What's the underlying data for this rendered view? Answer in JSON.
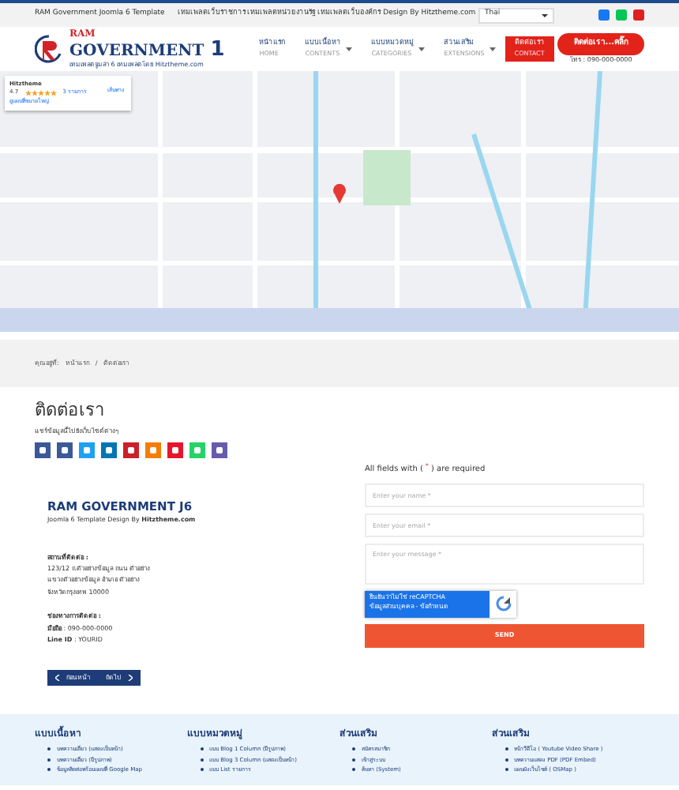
{
  "top_bar": {
    "site": "RAM Government Joomla 6 Template",
    "tagline": "เทมเพลตเว็บราชการ เทมเพลตหน่วยงานรัฐ เทมเพลตเว็บองค์กร Design By Hitztheme.com",
    "language": "Thai"
  },
  "logo": {
    "mark": "RAM",
    "name": "GOVERNMENT",
    "number": "1",
    "subtitle": "เทมเพลตจูมล่า 6 เทมเพลตโดย Hitztheme.com"
  },
  "nav": [
    {
      "label": "หน้าแรก",
      "sub": "HOME",
      "dropdown": false,
      "selected": false
    },
    {
      "label": "แบบเนื้อหา",
      "sub": "CONTENTS",
      "dropdown": true,
      "selected": false
    },
    {
      "label": "แบบหมวดหมู่",
      "sub": "CATEGORIES",
      "dropdown": true,
      "selected": false
    },
    {
      "label": "ส่วนเสริม",
      "sub": "EXTENSIONS",
      "dropdown": true,
      "selected": false
    },
    {
      "label": "ติดต่อเรา",
      "sub": "CONTACT",
      "dropdown": false,
      "selected": true
    }
  ],
  "cta": {
    "label": "ติดต่อเรา...คลิ๊ก",
    "phone": "โทร : 090-000-0000"
  },
  "map": {
    "kind": "picture",
    "place": {
      "name": "Hitztheme",
      "rating": "4.7",
      "stars": 5,
      "reviews": "3 รายการ",
      "directions": "เส้นทาง",
      "larger_map": "ดูแผนที่ขนาดใหญ่"
    }
  },
  "breadcrumb": {
    "prefix": "คุณอยู่ที่:",
    "items": [
      "หน้าแรก",
      "ติดต่อเรา"
    ],
    "separator": "/"
  },
  "title": "ติดต่อเรา",
  "share": {
    "text": "แชร์ข้อมูลนี้ไปยังเว็บไซต์ต่างๆ",
    "icons": [
      {
        "color": "#3b5998"
      },
      {
        "color": "#3d5a98"
      },
      {
        "color": "#1da1f2"
      },
      {
        "color": "#0077b5"
      },
      {
        "color": "#cb2027"
      },
      {
        "color": "#f57d00"
      },
      {
        "color": "#e6162d"
      },
      {
        "color": "#25d366"
      },
      {
        "color": "#665cac"
      }
    ]
  },
  "contact": {
    "name": "RAM GOVERNMENT J6",
    "byline": "Joomla 6 Template Design By **Hitztheme.com**",
    "address_heading": "สถานที่ติดต่อ :",
    "address": [
      "123/12 ถ.ตัวอย่างข้อมูล ถนน ตัวอย่าง",
      "แขวงตัวอย่างข้อมูล อำเภอ ตัวอย่าง",
      "จังหวัดกรุงเทพ 10000"
    ],
    "channels_heading": "ช่องทางการติดต่อ :",
    "channels": [
      "**มือถือ** : 090-000-0000",
      "**Line ID** : YOURID"
    ]
  },
  "pager": {
    "previous": "ก่อนหน้า",
    "next": "ถัดไป"
  },
  "form": {
    "note": "All fields with ( $^{*}$ ) are required",
    "fields": [
      {
        "kind": "input",
        "placeholder": "Enter your name *"
      },
      {
        "kind": "input",
        "placeholder": "Enter your email *"
      },
      {
        "kind": "textarea",
        "placeholder": "Enter your message *"
      }
    ],
    "captcha": [
      "ยืนยันว่าไม่ใช่ reCAPTCHA",
      "ข้อมูลส่วนบุคคล - ข้อกำหนด"
    ],
    "submit": "SEND"
  },
  "footer": [
    {
      "heading": "แบบเนื้อหา",
      "items": [
        "บทความเดี่ยว (แสดงเป็นหน้า)",
        "บทความเดี่ยว (มีรูปภาพ)",
        "ข้อมูลติดต่อพร้อมแผนที่ Google Map"
      ]
    },
    {
      "heading": "แบบหมวดหมู่",
      "items": [
        "แบบ Blog 1 Column (มีรูปภาพ)",
        "แบบ Blog 3 Column (แสดงเป็นหน้า)",
        "แบบ List รายการ"
      ]
    },
    {
      "heading": "ส่วนเสริม",
      "items": [
        "สมัครสมาชิก",
        "เข้าสู่ระบบ",
        "ค้นหา (System)"
      ]
    },
    {
      "heading": "ส่วนเสริม",
      "items": [
        "หน้าวีดีโอ ( Youtube Video Share )",
        "บทความแสดง PDF (PDF Embed)",
        "แผนผังเว็บไซต์ ( OSMap )"
      ]
    }
  ]
}
